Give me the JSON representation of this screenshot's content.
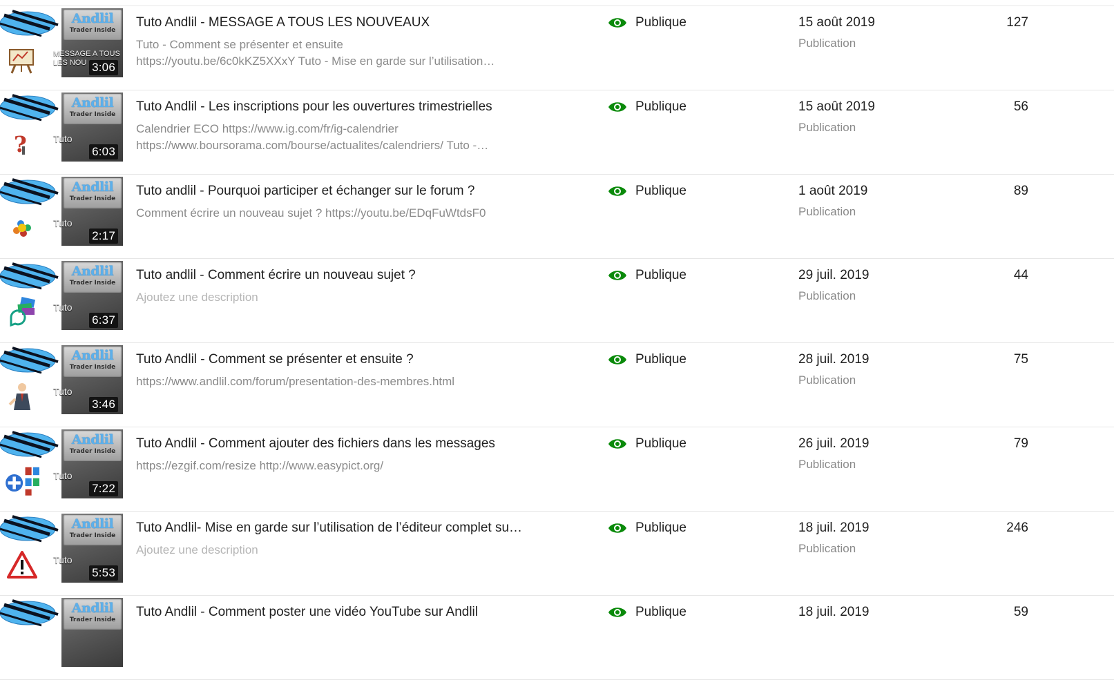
{
  "visibility_icon_color": "#0a8a0a",
  "rows": [
    {
      "title": "Tuto Andlil - MESSAGE A TOUS LES NOUVEAUX",
      "description_lines": [
        "Tuto - Comment se présenter et ensuite",
        "https://youtu.be/6c0kKZ5XXxY Tuto - Mise en garde sur l’utilisation…"
      ],
      "description_placeholder": false,
      "visibility": "Publique",
      "date": "15 août 2019",
      "date_sub": "Publication",
      "views": "127",
      "thumb_text": "MESSAGE A TOUS LES NOU",
      "duration": "3:06",
      "sticker": "easel-icon"
    },
    {
      "title": "Tuto Andlil - Les inscriptions pour les ouvertures trimestrielles",
      "description_lines": [
        "Calendrier ECO https://www.ig.com/fr/ig-calendrier",
        "https://www.boursorama.com/bourse/actualites/calendriers/ Tuto -…"
      ],
      "description_placeholder": false,
      "visibility": "Publique",
      "date": "15 août 2019",
      "date_sub": "Publication",
      "views": "56",
      "thumb_text": "Tuto",
      "duration": "6:03",
      "sticker": "question-mark-icon"
    },
    {
      "title": "Tuto andlil - Pourquoi participer et échanger sur le forum ?",
      "description_lines": [
        "Comment écrire un nouveau sujet ? https://youtu.be/EDqFuWtdsF0"
      ],
      "description_placeholder": false,
      "visibility": "Publique",
      "date": "1 août 2019",
      "date_sub": "Publication",
      "views": "89",
      "thumb_text": "Tuto",
      "duration": "2:17",
      "sticker": "people-circle-icon"
    },
    {
      "title": "Tuto andlil - Comment écrire un nouveau sujet ?",
      "description_lines": [
        "Ajoutez une description"
      ],
      "description_placeholder": true,
      "visibility": "Publique",
      "date": "29 juil. 2019",
      "date_sub": "Publication",
      "views": "44",
      "thumb_text": "Tuto",
      "duration": "6:37",
      "sticker": "chat-cards-icon"
    },
    {
      "title": "Tuto Andlil - Comment se présenter et ensuite ?",
      "description_lines": [
        "https://www.andlil.com/forum/presentation-des-membres.html"
      ],
      "description_placeholder": false,
      "visibility": "Publique",
      "date": "28 juil. 2019",
      "date_sub": "Publication",
      "views": "75",
      "thumb_text": "Tuto",
      "duration": "3:46",
      "sticker": "person-presenting-icon"
    },
    {
      "title": "Tuto Andlil - Comment ajouter des fichiers dans les messages",
      "description_lines": [
        "https://ezgif.com/resize http://www.easypict.org/"
      ],
      "description_placeholder": false,
      "visibility": "Publique",
      "date": "26 juil. 2019",
      "date_sub": "Publication",
      "views": "79",
      "thumb_text": "Tuto",
      "duration": "7:22",
      "sticker": "add-files-icon"
    },
    {
      "title": "Tuto Andlil- Mise en garde sur l’utilisation de l’éditeur complet su…",
      "description_lines": [
        "Ajoutez une description"
      ],
      "description_placeholder": true,
      "visibility": "Publique",
      "date": "18 juil. 2019",
      "date_sub": "Publication",
      "views": "246",
      "thumb_text": "Tuto",
      "duration": "5:53",
      "sticker": "warning-icon"
    },
    {
      "title": "Tuto Andlil - Comment poster une vidéo YouTube sur Andlil",
      "description_lines": [],
      "description_placeholder": false,
      "visibility": "Publique",
      "date": "18 juil. 2019",
      "date_sub": "",
      "views": "59",
      "thumb_text": "",
      "duration": "",
      "sticker": ""
    }
  ]
}
